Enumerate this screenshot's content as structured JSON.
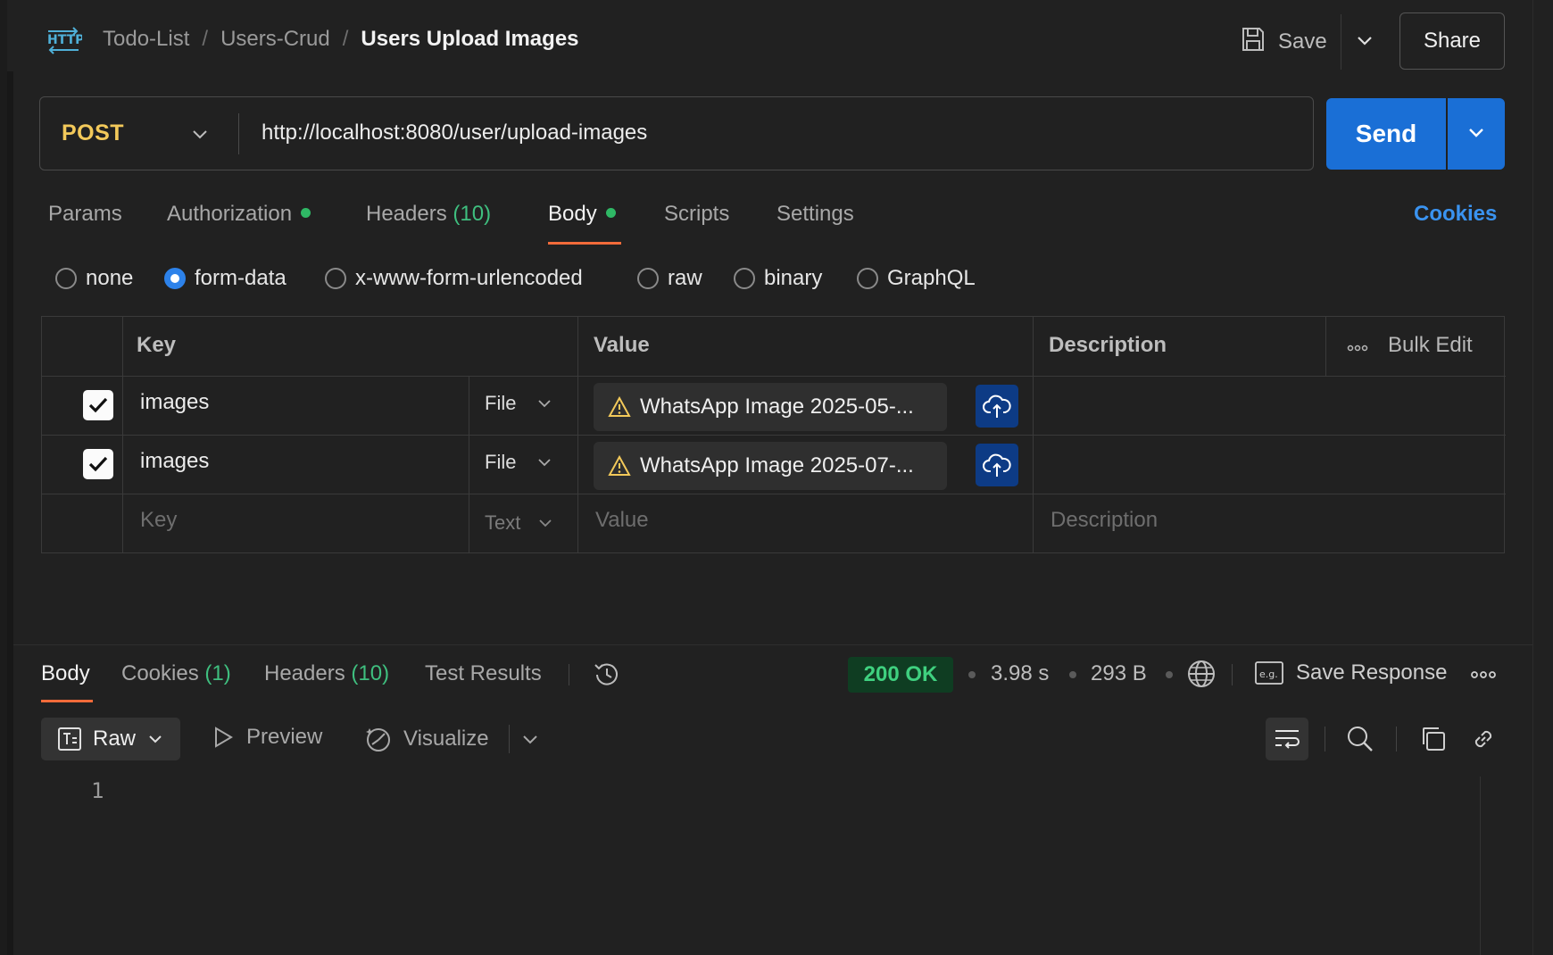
{
  "colors": {
    "background": "#212121",
    "accent_blue": "#1a6fd6",
    "method_yellow": "#f3c95a",
    "tab_underline": "#f26b3a",
    "status_green": "#3fd07f",
    "count_green": "#3fbf7f"
  },
  "header": {
    "app_icon": "http-icon",
    "breadcrumb": [
      "Todo-List",
      "Users-Crud"
    ],
    "breadcrumb_separator": "/",
    "current": "Users Upload Images",
    "save_label": "Save",
    "share_label": "Share"
  },
  "request": {
    "method": "POST",
    "url": "http://localhost:8080/user/upload-images",
    "send_label": "Send"
  },
  "request_tabs": {
    "params": "Params",
    "authorization": "Authorization",
    "headers": "Headers",
    "headers_count": "(10)",
    "body": "Body",
    "scripts": "Scripts",
    "settings": "Settings",
    "active": "Body",
    "cookies_link": "Cookies"
  },
  "body_types": {
    "none": "none",
    "form_data": "form-data",
    "urlencoded": "x-www-form-urlencoded",
    "raw": "raw",
    "binary": "binary",
    "graphql": "GraphQL",
    "selected": "form-data"
  },
  "params_table": {
    "headers": {
      "key": "Key",
      "value": "Value",
      "description": "Description",
      "bulk_edit": "Bulk Edit"
    },
    "rows": [
      {
        "checked": true,
        "key": "images",
        "type": "File",
        "value": "WhatsApp Image 2025-05-...",
        "description": ""
      },
      {
        "checked": true,
        "key": "images",
        "type": "File",
        "value": "WhatsApp Image 2025-07-...",
        "description": ""
      }
    ],
    "new_row": {
      "key_placeholder": "Key",
      "type": "Text",
      "value_placeholder": "Value",
      "description_placeholder": "Description"
    }
  },
  "response": {
    "tabs": {
      "body": "Body",
      "cookies": "Cookies",
      "cookies_count": "(1)",
      "headers": "Headers",
      "headers_count": "(10)",
      "test_results": "Test Results",
      "active": "Body"
    },
    "status": "200 OK",
    "time": "3.98 s",
    "size": "293 B",
    "save_response": "Save Response",
    "format": "Raw",
    "preview_label": "Preview",
    "visualize_label": "Visualize",
    "line_numbers": [
      "1"
    ]
  }
}
